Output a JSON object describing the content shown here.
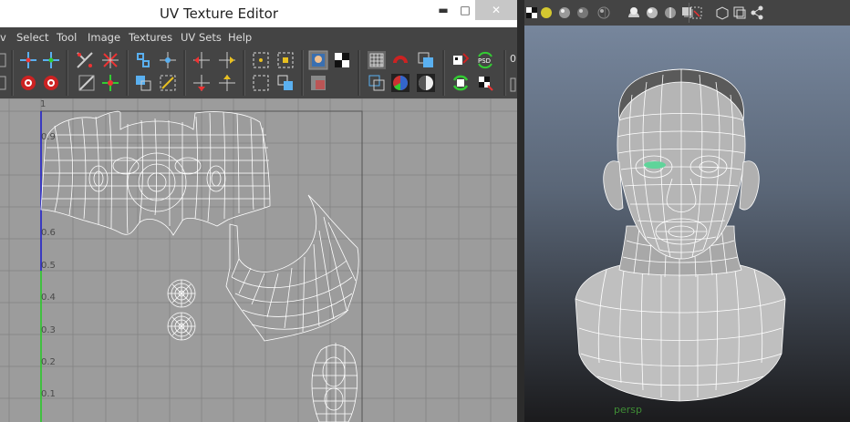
{
  "window": {
    "title": "UV Texture Editor",
    "minimize_symbol": "▬",
    "maximize_symbol": "□",
    "close_symbol": "✕"
  },
  "menubar": {
    "items": [
      "Select",
      "Tool",
      "Image",
      "Textures",
      "UV Sets",
      "Help"
    ],
    "cut_item": "v"
  },
  "uv_editor": {
    "grid_labels": [
      "1",
      "0.9",
      "0.6",
      "0.5",
      "0.4",
      "0.3",
      "0.2",
      "0.1"
    ]
  },
  "toolbar": {
    "psd_label": "PSD",
    "field_cut": "0"
  },
  "viewport": {
    "camera_label": "persp"
  },
  "colors": {
    "axis_v": "#1a1acc",
    "axis_u": "#22cc22",
    "wire": "#ffffff",
    "selection": "#5fd49a"
  }
}
